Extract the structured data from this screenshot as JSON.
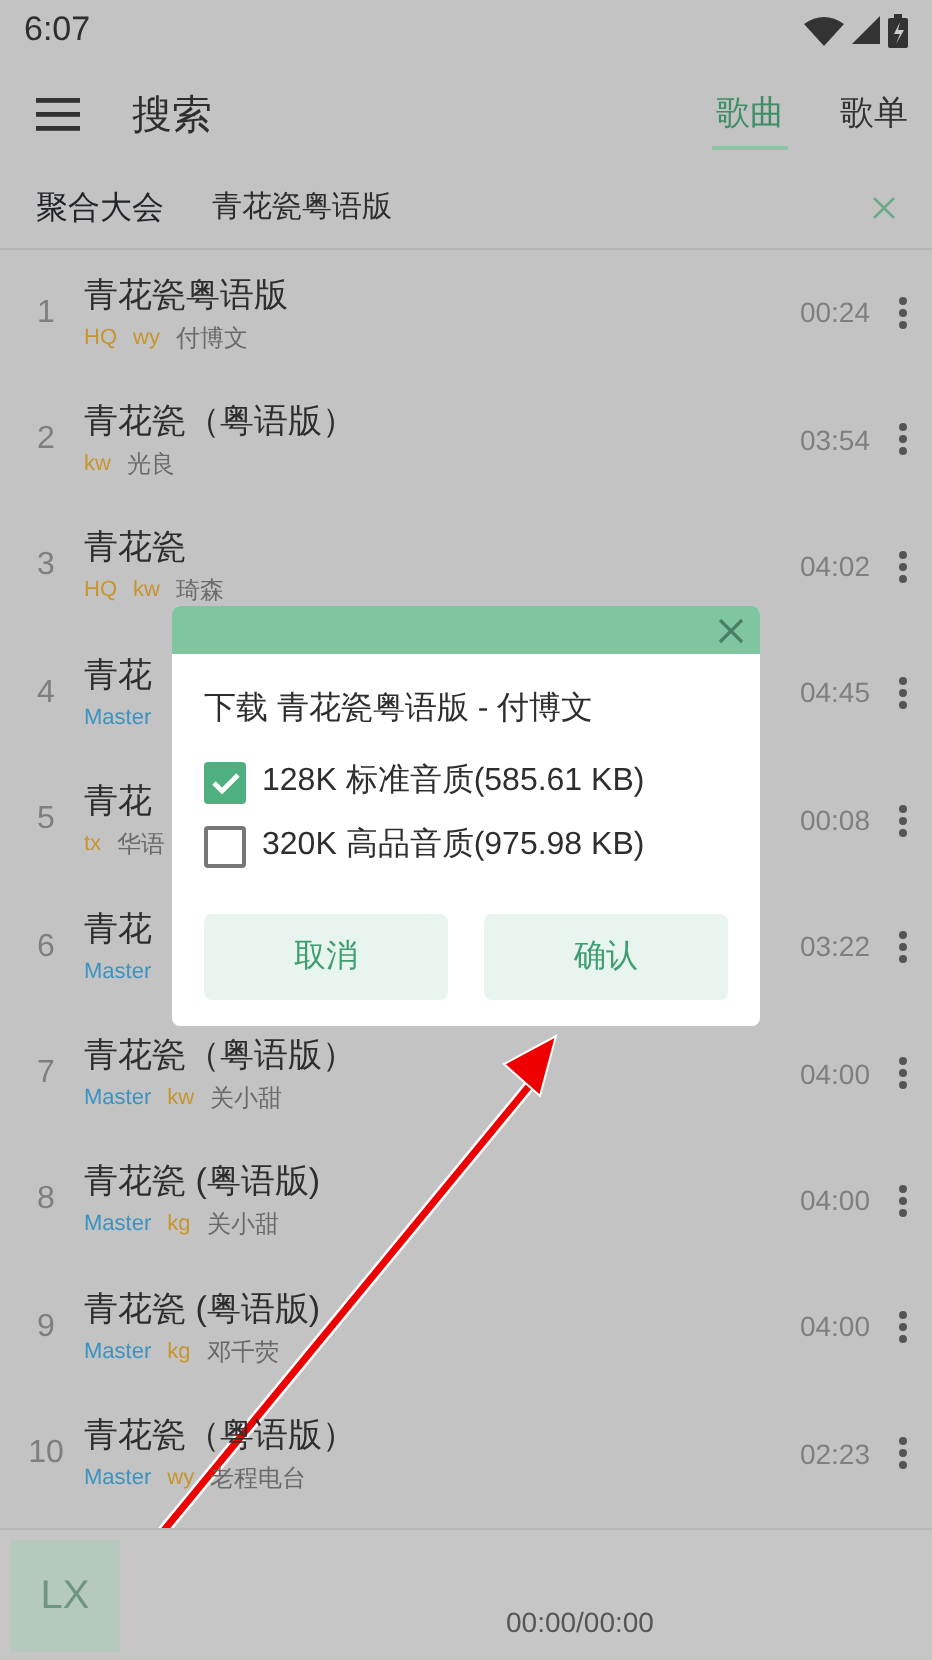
{
  "status_bar": {
    "time": "6:07"
  },
  "header": {
    "title": "搜索",
    "tabs": [
      {
        "label": "歌曲",
        "selected": true
      },
      {
        "label": "歌单",
        "selected": false
      }
    ]
  },
  "search": {
    "source": "聚合大会",
    "query": "青花瓷粤语版"
  },
  "songs": [
    {
      "index": "1",
      "title": "青花瓷粤语版",
      "tags": [
        {
          "text": "HQ",
          "color": "#c8952c"
        },
        {
          "text": "wy",
          "color": "#c8952c"
        }
      ],
      "artist": "付博文",
      "duration": "00:24"
    },
    {
      "index": "2",
      "title": "青花瓷（粤语版）",
      "tags": [
        {
          "text": "kw",
          "color": "#c8952c"
        }
      ],
      "artist": "光良",
      "duration": "03:54"
    },
    {
      "index": "3",
      "title": "青花瓷",
      "tags": [
        {
          "text": "HQ",
          "color": "#c8952c"
        },
        {
          "text": "kw",
          "color": "#c8952c"
        }
      ],
      "artist": "琦森",
      "duration": "04:02"
    },
    {
      "index": "4",
      "title": "青花",
      "tags": [
        {
          "text": "Master",
          "color": "#3a93c0"
        }
      ],
      "duration": "04:45"
    },
    {
      "index": "5",
      "title": "青花",
      "tags": [
        {
          "text": "tx",
          "color": "#c8952c"
        }
      ],
      "artist": "华语",
      "duration": "00:08"
    },
    {
      "index": "6",
      "title": "青花",
      "tags": [
        {
          "text": "Master",
          "color": "#3a93c0"
        }
      ],
      "duration": "03:22"
    },
    {
      "index": "7",
      "title": "青花瓷（粤语版）",
      "tags": [
        {
          "text": "Master",
          "color": "#3a93c0"
        },
        {
          "text": "kw",
          "color": "#c8952c"
        }
      ],
      "artist": "关小甜",
      "duration": "04:00"
    },
    {
      "index": "8",
      "title": "青花瓷 (粤语版)",
      "tags": [
        {
          "text": "Master",
          "color": "#3a93c0"
        },
        {
          "text": "kg",
          "color": "#c8952c"
        }
      ],
      "artist": "关小甜",
      "duration": "04:00"
    },
    {
      "index": "9",
      "title": "青花瓷 (粤语版)",
      "tags": [
        {
          "text": "Master",
          "color": "#3a93c0"
        },
        {
          "text": "kg",
          "color": "#c8952c"
        }
      ],
      "artist": "邓千荧",
      "duration": "04:00"
    },
    {
      "index": "10",
      "title": "青花瓷（粤语版）",
      "tags": [
        {
          "text": "Master",
          "color": "#3a93c0"
        },
        {
          "text": "wy",
          "color": "#c8952c"
        }
      ],
      "artist": "老程电台",
      "duration": "02:23"
    }
  ],
  "player": {
    "logo": "LX",
    "time": "00:00/00:00"
  },
  "dialog": {
    "heading": "下载 青花瓷粤语版 - 付博文",
    "options": [
      {
        "label": "128K 标准音质(585.61 KB)",
        "checked": true
      },
      {
        "label": "320K 高品音质(975.98 KB)",
        "checked": false
      }
    ],
    "buttons": [
      "取消",
      "确认"
    ]
  }
}
